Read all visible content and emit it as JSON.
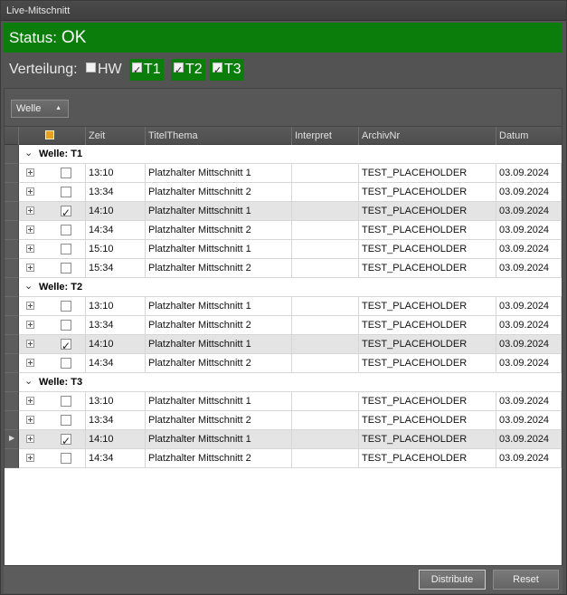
{
  "window": {
    "title": "Live-Mitschnitt"
  },
  "status": {
    "label": "Status:",
    "value": "OK",
    "color": "#0a7d0a"
  },
  "distribution": {
    "label": "Verteilung:",
    "options": [
      {
        "label": "HW",
        "checked": false
      },
      {
        "label": "T1",
        "checked": true
      },
      {
        "label": "T2",
        "checked": true
      },
      {
        "label": "T3",
        "checked": true
      }
    ]
  },
  "grouping": {
    "chip_label": "Welle",
    "sort_icon": "sort-up-icon"
  },
  "columns": {
    "zeit": "Zeit",
    "titel": "TitelThema",
    "interpret": "Interpret",
    "archiv": "ArchivNr",
    "datum": "Datum"
  },
  "groups": [
    {
      "title": "Welle: T1",
      "rows": [
        {
          "zeit": "13:10",
          "titel": "Platzhalter Mittschnitt 1",
          "interpret": "",
          "archiv": "TEST_PLACEHOLDER",
          "datum": "03.09.2024",
          "checked": false
        },
        {
          "zeit": "13:34",
          "titel": "Platzhalter Mittschnitt 2",
          "interpret": "",
          "archiv": "TEST_PLACEHOLDER",
          "datum": "03.09.2024",
          "checked": false
        },
        {
          "zeit": "14:10",
          "titel": "Platzhalter Mittschnitt 1",
          "interpret": "",
          "archiv": "TEST_PLACEHOLDER",
          "datum": "03.09.2024",
          "checked": true
        },
        {
          "zeit": "14:34",
          "titel": "Platzhalter Mittschnitt 2",
          "interpret": "",
          "archiv": "TEST_PLACEHOLDER",
          "datum": "03.09.2024",
          "checked": false
        },
        {
          "zeit": "15:10",
          "titel": "Platzhalter Mittschnitt 1",
          "interpret": "",
          "archiv": "TEST_PLACEHOLDER",
          "datum": "03.09.2024",
          "checked": false
        },
        {
          "zeit": "15:34",
          "titel": "Platzhalter Mittschnitt 2",
          "interpret": "",
          "archiv": "TEST_PLACEHOLDER",
          "datum": "03.09.2024",
          "checked": false
        }
      ]
    },
    {
      "title": "Welle: T2",
      "rows": [
        {
          "zeit": "13:10",
          "titel": "Platzhalter Mittschnitt 1",
          "interpret": "",
          "archiv": "TEST_PLACEHOLDER",
          "datum": "03.09.2024",
          "checked": false
        },
        {
          "zeit": "13:34",
          "titel": "Platzhalter Mittschnitt 2",
          "interpret": "",
          "archiv": "TEST_PLACEHOLDER",
          "datum": "03.09.2024",
          "checked": false
        },
        {
          "zeit": "14:10",
          "titel": "Platzhalter Mittschnitt 1",
          "interpret": "",
          "archiv": "TEST_PLACEHOLDER",
          "datum": "03.09.2024",
          "checked": true
        },
        {
          "zeit": "14:34",
          "titel": "Platzhalter Mittschnitt 2",
          "interpret": "",
          "archiv": "TEST_PLACEHOLDER",
          "datum": "03.09.2024",
          "checked": false
        }
      ]
    },
    {
      "title": "Welle: T3",
      "rows": [
        {
          "zeit": "13:10",
          "titel": "Platzhalter Mittschnitt 1",
          "interpret": "",
          "archiv": "TEST_PLACEHOLDER",
          "datum": "03.09.2024",
          "checked": false
        },
        {
          "zeit": "13:34",
          "titel": "Platzhalter Mittschnitt 2",
          "interpret": "",
          "archiv": "TEST_PLACEHOLDER",
          "datum": "03.09.2024",
          "checked": false
        },
        {
          "zeit": "14:10",
          "titel": "Platzhalter Mittschnitt 1",
          "interpret": "",
          "archiv": "TEST_PLACEHOLDER",
          "datum": "03.09.2024",
          "checked": true,
          "current": true
        },
        {
          "zeit": "14:34",
          "titel": "Platzhalter Mittschnitt 2",
          "interpret": "",
          "archiv": "TEST_PLACEHOLDER",
          "datum": "03.09.2024",
          "checked": false
        }
      ]
    }
  ],
  "footer": {
    "distribute_label": "Distribute",
    "reset_label": "Reset"
  }
}
